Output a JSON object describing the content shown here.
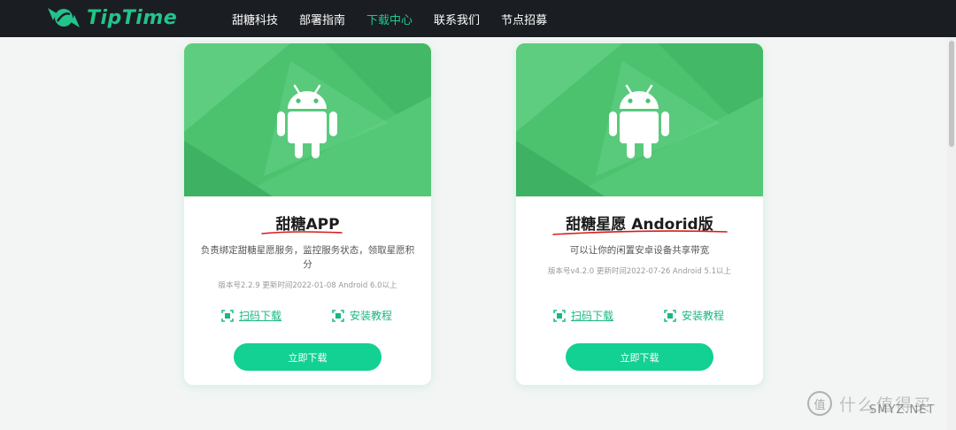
{
  "header": {
    "logo_text": "TipTime",
    "nav": [
      {
        "label": "甜糖科技",
        "active": false
      },
      {
        "label": "部署指南",
        "active": false
      },
      {
        "label": "下载中心",
        "active": true
      },
      {
        "label": "联系我们",
        "active": false
      },
      {
        "label": "节点招募",
        "active": false
      }
    ]
  },
  "cards": [
    {
      "title": "甜糖APP",
      "description": "负责绑定甜糖星愿服务，监控服务状态，领取星愿积分",
      "meta": "版本号2.2.9   更新时间2022-01-08   Android 6.0以上",
      "scan_label": "扫码下载",
      "guide_label": "安装教程",
      "button_label": "立即下载",
      "icon": "android-icon"
    },
    {
      "title": "甜糖星愿 Andorid版",
      "description": "可以让你的闲置安卓设备共享带宽",
      "meta": "版本号v4.2.0   更新时间2022-07-26   Android 5.1以上",
      "scan_label": "扫码下载",
      "guide_label": "安装教程",
      "button_label": "立即下载",
      "icon": "android-icon"
    }
  ],
  "watermark": {
    "logo_char": "值",
    "chinese": "什么值得买",
    "site": "SMYZ.NET"
  },
  "colors": {
    "header_bg": "#1a1d22",
    "accent": "#20c98e",
    "banner": "#4cc26f",
    "button": "#13d093",
    "annotation": "#d81b1b"
  }
}
